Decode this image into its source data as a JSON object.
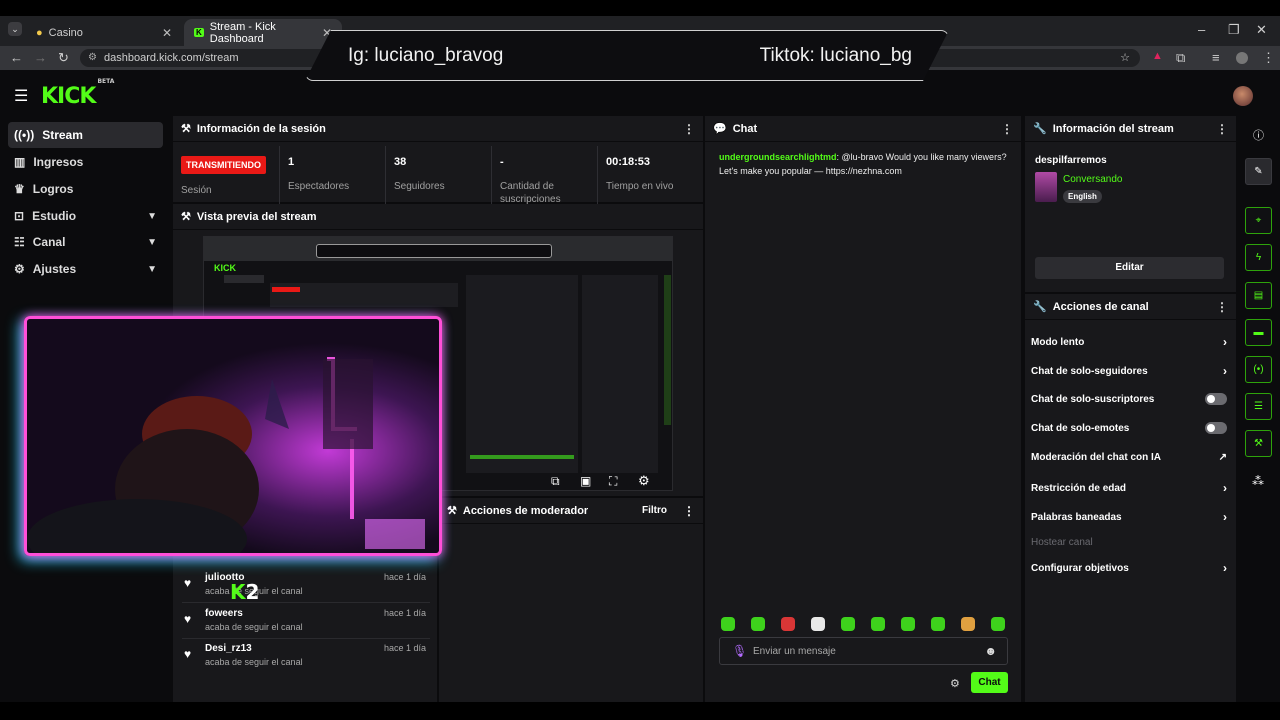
{
  "browser": {
    "tabs": [
      {
        "label": "Casino"
      },
      {
        "label": "Stream - Kick Dashboard"
      }
    ],
    "url": "dashboard.kick.com/stream"
  },
  "overlay": {
    "left": "Ig: luciano_bravog",
    "right": "Tiktok: luciano_bg"
  },
  "brand": {
    "logo": "KICK",
    "tag": "BETA"
  },
  "sidebar": {
    "items": [
      {
        "label": "Stream",
        "icon": "broadcast-icon"
      },
      {
        "label": "Ingresos",
        "icon": "chart-icon"
      },
      {
        "label": "Logros",
        "icon": "trophy-icon"
      },
      {
        "label": "Estudio",
        "icon": "studio-icon"
      },
      {
        "label": "Canal",
        "icon": "channel-icon"
      },
      {
        "label": "Ajustes",
        "icon": "gear-icon"
      }
    ]
  },
  "session": {
    "title": "Información de la sesión",
    "status_badge": "TRANSMITIENDO",
    "status_label": "Sesión",
    "stats": [
      {
        "value": "1",
        "label": "Espectadores"
      },
      {
        "value": "38",
        "label": "Seguidores"
      },
      {
        "value": "-",
        "label": "Cantidad de suscripciones"
      },
      {
        "value": "00:18:53",
        "label": "Tiempo en vivo"
      }
    ]
  },
  "preview": {
    "title": "Vista previa del stream"
  },
  "moderator": {
    "title": "Acciones de moderador",
    "filter": "Filtro"
  },
  "followers": [
    {
      "name": "juliootto",
      "action": "acaba de seguir el canal",
      "time": "hace 1 día"
    },
    {
      "name": "foweers",
      "action": "acaba de seguir el canal",
      "time": "hace 1 día"
    },
    {
      "name": "Desi_rz13",
      "action": "acaba de seguir el canal",
      "time": "hace 1 día"
    }
  ],
  "webcam_badge": "2",
  "chat": {
    "title": "Chat",
    "messages": [
      {
        "user": "undergroundsearchlightmd",
        "text": "@lu-bravo Would you like many viewers? Let's make you popular — https://nezhna.com"
      }
    ],
    "placeholder": "Enviar un mensaje",
    "send_label": "Chat"
  },
  "stream_info": {
    "title": "Información del stream",
    "stream_title": "despilfarremos",
    "category": "Conversando",
    "language": "English",
    "edit_label": "Editar"
  },
  "channel_actions": {
    "title": "Acciones de canal",
    "items": [
      {
        "label": "Modo lento",
        "control": "arrow"
      },
      {
        "label": "Chat de solo-seguidores",
        "control": "arrow"
      },
      {
        "label": "Chat de solo-suscriptores",
        "control": "toggle",
        "on": false
      },
      {
        "label": "Chat de solo-emotes",
        "control": "toggle",
        "on": false
      },
      {
        "label": "Moderación del chat con IA",
        "control": "external"
      },
      {
        "label": "Restricción de edad",
        "control": "arrow"
      },
      {
        "label": "Palabras baneadas",
        "control": "arrow"
      },
      {
        "label": "Hostear canal",
        "control": "disabled"
      },
      {
        "label": "Configurar objetivos",
        "control": "arrow"
      }
    ]
  },
  "colors": {
    "accent": "#53fc18",
    "live": "#e91916",
    "panel": "#18181b",
    "bg": "#0b0b0d"
  }
}
